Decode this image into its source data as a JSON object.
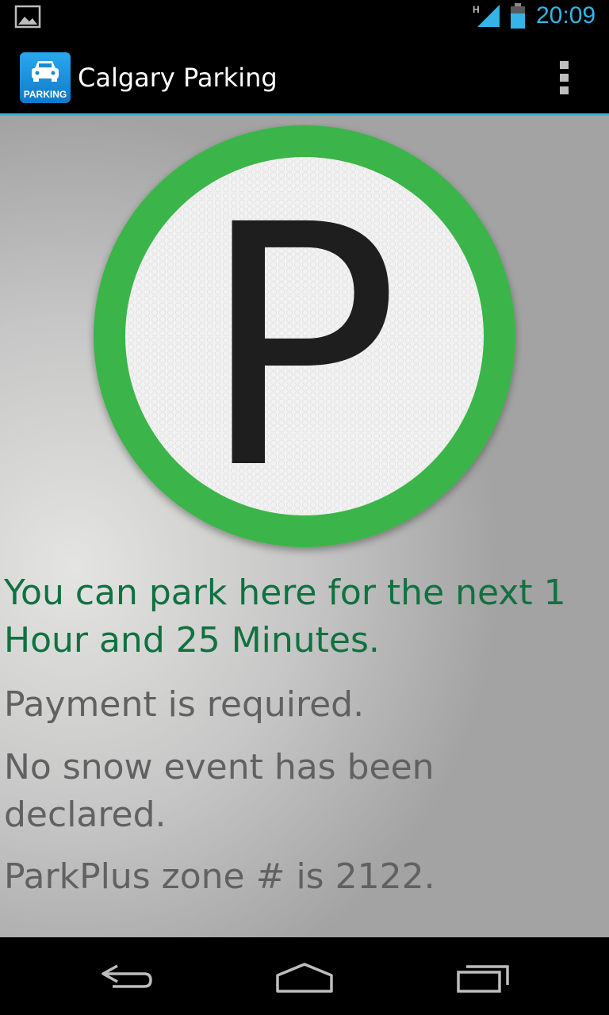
{
  "status_bar": {
    "time": "20:09",
    "network_type": "H",
    "notification_icon": "image-icon",
    "signal_icon": "signal-icon",
    "battery_icon": "battery-icon"
  },
  "action_bar": {
    "app_icon": "parking-car-icon",
    "app_icon_label": "PARKING",
    "title": "Calgary Parking",
    "menu_icon": "overflow-menu-icon"
  },
  "sign": {
    "letter": "P",
    "ring_color": "#3bb54a",
    "face_color": "#f2f2f2"
  },
  "messages": {
    "park_duration": "You can park here for the next 1 Hour and 25 Minutes.",
    "payment": "Payment is required.",
    "snow": "No snow event has been declared.",
    "zone": "ParkPlus zone # is 2122."
  },
  "colors": {
    "accent": "#33b5e5",
    "positive_text": "#11713f",
    "secondary_text": "#616161"
  },
  "nav_bar": {
    "back_icon": "back-icon",
    "home_icon": "home-icon",
    "recents_icon": "recent-apps-icon"
  }
}
